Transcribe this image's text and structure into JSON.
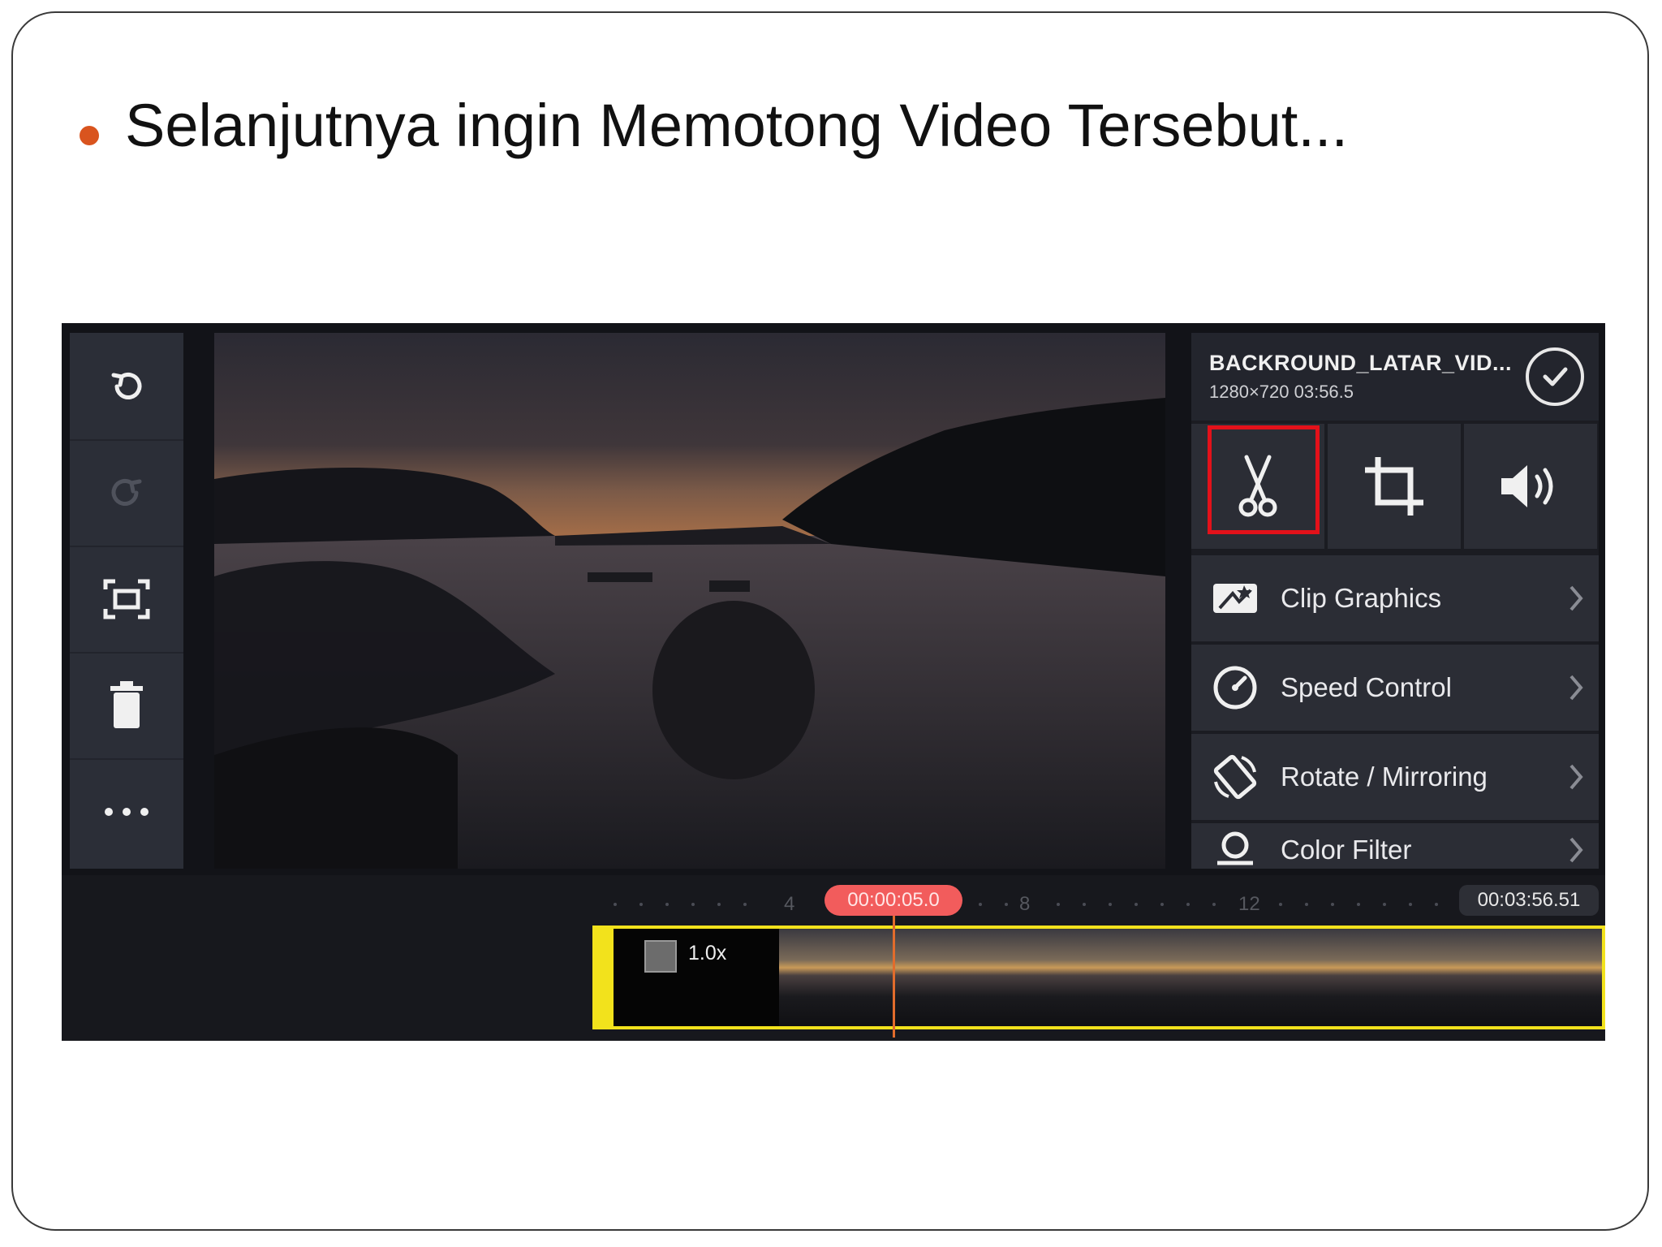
{
  "slide": {
    "title": "Selanjutnya ingin Memotong Video Tersebut..."
  },
  "app": {
    "clip": {
      "name": "BACKROUND_LATAR_VID...",
      "meta": "1280×720  03:56.5"
    },
    "tools": [
      {
        "name": "split",
        "icon": "scissors-icon",
        "highlighted": true
      },
      {
        "name": "crop",
        "icon": "crop-icon"
      },
      {
        "name": "volume",
        "icon": "volume-icon"
      }
    ],
    "menu": [
      {
        "label": "Clip Graphics",
        "icon": "clip-graphics-icon"
      },
      {
        "label": "Speed Control",
        "icon": "speed-gauge-icon"
      },
      {
        "label": "Rotate / Mirroring",
        "icon": "rotate-icon"
      },
      {
        "label": "Color Filter",
        "icon": "color-filter-icon"
      }
    ],
    "left_toolbar": [
      "undo-icon",
      "redo-icon",
      "fullscreen-icon",
      "trash-icon",
      "more-icon"
    ],
    "timeline": {
      "playhead_time": "00:00:05.0",
      "total_time": "00:03:56.51",
      "ruler_marks": [
        "4",
        "8",
        "12"
      ],
      "speed": "1.0x"
    },
    "colors": {
      "highlight": "#e3111a",
      "clip_border": "#f2e21c",
      "playhead": "#f25c5c",
      "bullet": "#d9541e"
    }
  }
}
